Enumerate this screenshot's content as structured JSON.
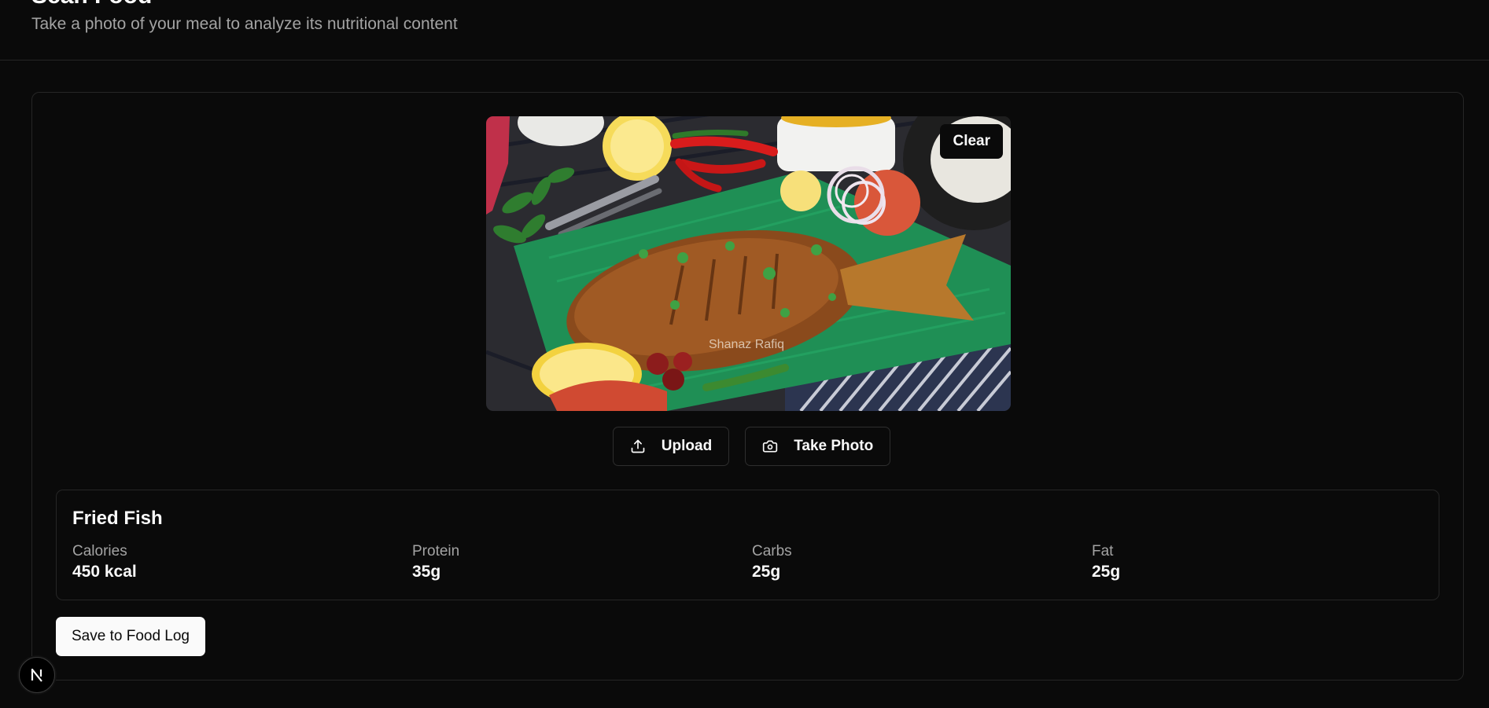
{
  "header": {
    "title": "Scan Food",
    "subtitle": "Take a photo of your meal to analyze its nutritional content"
  },
  "photo": {
    "icon": "fried-fish-photo",
    "watermark": "Shanaz Rafiq",
    "clear_label": "Clear"
  },
  "actions": {
    "upload_label": "Upload",
    "upload_icon": "upload-icon",
    "take_photo_label": "Take Photo",
    "take_photo_icon": "camera-icon"
  },
  "result": {
    "food_name": "Fried Fish",
    "nutrients": [
      {
        "label": "Calories",
        "value": "450 kcal"
      },
      {
        "label": "Protein",
        "value": "35g"
      },
      {
        "label": "Carbs",
        "value": "25g"
      },
      {
        "label": "Fat",
        "value": "25g"
      }
    ]
  },
  "save_label": "Save to Food Log",
  "badge": {
    "letter": "N",
    "icon": "nextjs-logo-icon"
  },
  "colors": {
    "background": "#0a0a0a",
    "border": "#262626",
    "muted_text": "#a3a3a3",
    "primary_button": "#fafafa"
  }
}
